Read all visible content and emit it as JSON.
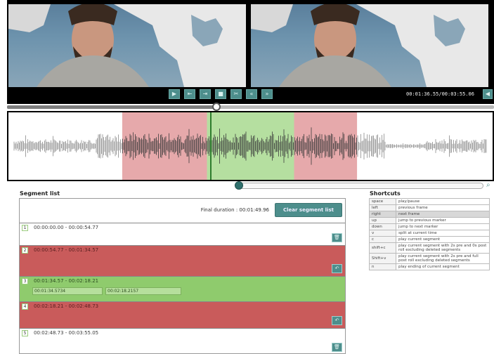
{
  "player": {
    "controls": [
      {
        "icon": "play-icon",
        "glyph": "▶"
      },
      {
        "icon": "previous-frame-icon",
        "glyph": "⇤"
      },
      {
        "icon": "next-frame-icon",
        "glyph": "⇥"
      },
      {
        "icon": "stop-icon",
        "glyph": "■"
      },
      {
        "icon": "split-icon",
        "glyph": "✂"
      },
      {
        "icon": "jump-previous-icon",
        "glyph": "«"
      },
      {
        "icon": "jump-next-icon",
        "glyph": "»"
      }
    ],
    "time_readout": "00:01:36.55/00:03:55.06",
    "nav_glyph": "◀",
    "seek_progress": 0.43
  },
  "waveform": {
    "regions": [
      {
        "start": 0.235,
        "end": 0.41,
        "color": "#e6a9ab"
      },
      {
        "start": 0.41,
        "end": 0.59,
        "color": "#b5dfa0"
      },
      {
        "start": 0.59,
        "end": 0.72,
        "color": "#e6a9ab"
      }
    ],
    "cursor": 0.418
  },
  "segment_list": {
    "title": "Segment list",
    "final_duration": "Final duration : 00:01:49.96",
    "clear_button": "Clear segment list",
    "segments": [
      {
        "num": "1",
        "range": "00:00:00.00 - 00:00:54.77",
        "state": "white",
        "action": "🗑"
      },
      {
        "num": "2",
        "range": "00:00:54.77 - 00:01:34.57",
        "state": "red",
        "action": "↶"
      },
      {
        "num": "3",
        "range": "00:01:34.57 - 00:02:18.21",
        "state": "green",
        "start_value": "00:01:34.5734",
        "end_value": "00:02:18.2157"
      },
      {
        "num": "4",
        "range": "00:02:18.21 - 00:02:48.73",
        "state": "red",
        "action": "↶"
      },
      {
        "num": "5",
        "range": "00:02:48.73 - 00:03:55.05",
        "state": "white",
        "action": "🗑"
      }
    ]
  },
  "shortcuts": {
    "title": "Shortcuts",
    "rows": [
      {
        "key": "space",
        "desc": "play/pause"
      },
      {
        "key": "left",
        "desc": "previous frame"
      },
      {
        "key": "right",
        "desc": "next frame",
        "highlight": true
      },
      {
        "key": "up",
        "desc": "jump to previous marker"
      },
      {
        "key": "down",
        "desc": "jump to next marker"
      },
      {
        "key": "v",
        "desc": "split at current time"
      },
      {
        "key": "c",
        "desc": "play current segment"
      },
      {
        "key": "shift+c",
        "desc": "play current segment with 2s pre and 0s post roll excluding deleted segments"
      },
      {
        "key": "Shift+v",
        "desc": "play current segment with 2s pre and full post roll excluding deleted segments"
      },
      {
        "key": "n",
        "desc": "play ending of current segment"
      }
    ]
  },
  "zoom": {
    "icon": "zoom-icon",
    "glyph": "⌕",
    "level": 0.0
  }
}
